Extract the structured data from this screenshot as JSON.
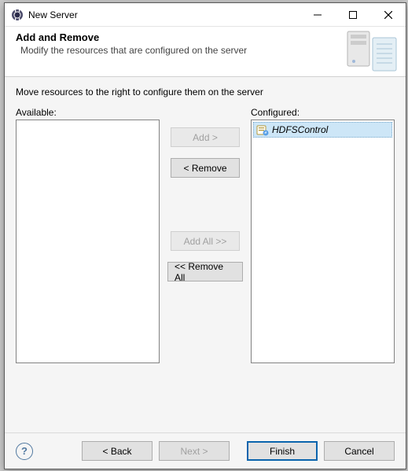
{
  "window": {
    "title": "New Server"
  },
  "banner": {
    "heading": "Add and Remove",
    "subheading": "Modify the resources that are configured on the server"
  },
  "instruction": "Move resources to the right to configure them on the server",
  "lists": {
    "available_label": "Available:",
    "configured_label": "Configured:",
    "available_items": [],
    "configured_items": [
      "HDFSControl"
    ]
  },
  "buttons": {
    "add": "Add >",
    "remove": "< Remove",
    "add_all": "Add All >>",
    "remove_all": "<< Remove All"
  },
  "footer": {
    "help": "?",
    "back": "< Back",
    "next": "Next >",
    "finish": "Finish",
    "cancel": "Cancel"
  }
}
